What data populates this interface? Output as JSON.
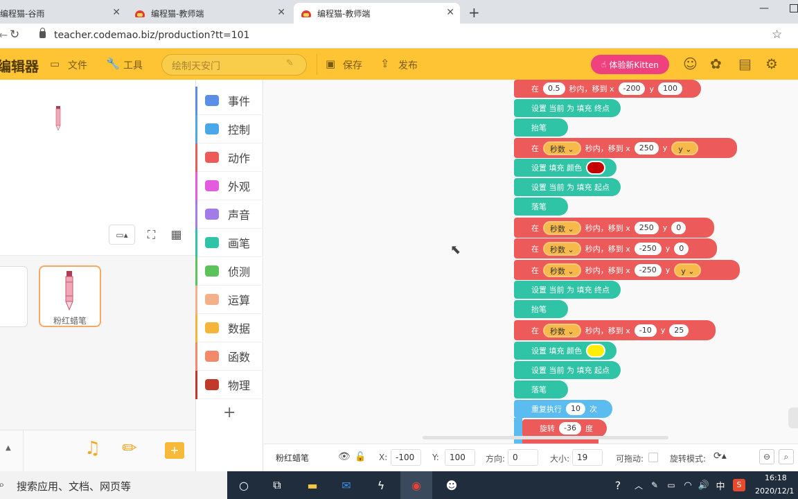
{
  "browser": {
    "tabs": [
      {
        "title": "编程猫-谷雨"
      },
      {
        "title": "编程猫-教师端"
      },
      {
        "title": "编程猫-教师端"
      }
    ],
    "new_tab": "+",
    "url": "teacher.codemao.biz/production?tt=101"
  },
  "app": {
    "brand": "编辑器",
    "menu": {
      "file": "文件",
      "tools": "工具",
      "save": "保存",
      "publish": "发布"
    },
    "project_name_placeholder": "绘制天安门",
    "try_kitten": "体验新Kitten"
  },
  "stage": {
    "sprites": [
      {
        "name": "粉红蜡笔",
        "selected": true
      }
    ]
  },
  "categories": [
    {
      "label": "事件",
      "color": "#5b8ee6"
    },
    {
      "label": "控制",
      "color": "#4aa8e8"
    },
    {
      "label": "动作",
      "color": "#ec5a5a"
    },
    {
      "label": "外观",
      "color": "#e35ce0"
    },
    {
      "label": "声音",
      "color": "#a27be8"
    },
    {
      "label": "画笔",
      "color": "#30c4a6"
    },
    {
      "label": "侦测",
      "color": "#5ac35a"
    },
    {
      "label": "运算",
      "color": "#f3b18a"
    },
    {
      "label": "数据",
      "color": "#f5b53a"
    },
    {
      "label": "函数",
      "color": "#f08a6a"
    },
    {
      "label": "物理",
      "color": "#c0392b"
    }
  ],
  "blocks": {
    "in": "在",
    "sec_in": "秒内，移到 x",
    "seconds": "秒数",
    "y": "y",
    "set_current": "设置 当前 为 填充 终点",
    "set_current_start": "设置 当前 为 填充 起点",
    "pen_up": "抬笔",
    "pen_down": "落笔",
    "set_fill_color": "设置 填充 颜色",
    "repeat": "重复执行",
    "times": "次",
    "rotate": "旋转",
    "degrees": "度",
    "v05": "0.5",
    "vm200": "-200",
    "v100": "100",
    "v250": "250",
    "v0": "0",
    "vm250": "-250",
    "vm10": "-10",
    "v25": "25",
    "v10": "10",
    "vm36": "-36",
    "color_red": "#c40000",
    "color_yellow": "#ffee00"
  },
  "info": {
    "sprite_name": "粉红蜡笔",
    "x_label": "X:",
    "x": "-100",
    "y_label": "Y:",
    "y": "100",
    "dir_label": "方向:",
    "dir": "0",
    "size_label": "大小:",
    "size": "19",
    "drag_label": "可拖动:",
    "rotate_label": "旋转模式:"
  },
  "taskbar": {
    "search": "搜索应用、文档、网页等",
    "ime": "中",
    "time": "16:18",
    "date": "2020/12/1"
  }
}
